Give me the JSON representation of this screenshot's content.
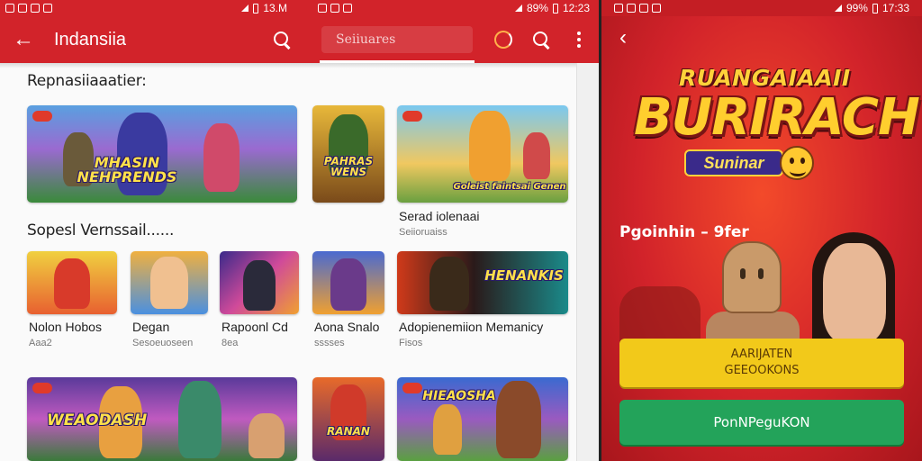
{
  "status_bars": {
    "left_time": "13.M",
    "mid_battery": "89%",
    "mid_time": "12:23",
    "right_battery": "99%",
    "right_time": "17:33"
  },
  "app_bar": {
    "title": "Indansiia",
    "search_placeholder": "Seiiuares"
  },
  "sections": [
    {
      "title": "Repnasiiaaatier:",
      "cards": [
        {
          "art_text": "MHASIN\nNEHPRENDS"
        },
        {
          "art_text": "PAHRAS\nWENS"
        },
        {
          "art_text": "Goleist faintsai Genen",
          "label": "Serad iolenaai",
          "sub": "Seiioruaiss"
        }
      ]
    },
    {
      "title": "Sopesl Vernssail......",
      "cards": [
        {
          "label": "Nolon Hobos",
          "sub": "Aaa2"
        },
        {
          "label": "Degan",
          "sub": "Sesoeuoseen"
        },
        {
          "label": "Rapoonl Cd",
          "sub": "8ea"
        },
        {
          "label": "Aona Snalo",
          "sub": "sssses"
        },
        {
          "art_text": "HENANKIS",
          "label": "Adopienemiion Memanicy",
          "sub": "Fisos"
        }
      ]
    },
    {
      "title": "",
      "cards": [
        {
          "art_text": "WEAODASH"
        },
        {
          "art_text": "RANAN"
        },
        {
          "art_text": "HIEAOSHA"
        }
      ]
    }
  ],
  "promo": {
    "logo_top": "RUANGAIAAII",
    "logo_main": "BURIRACH",
    "logo_sub": "Suninar",
    "heading": "Pgoinhin – 9fer",
    "btn_primary_line1": "AARIJATEN",
    "btn_primary_line2": "GEEOOKONS",
    "btn_secondary": "PonNPeguKON"
  },
  "colors": {
    "brand_red": "#d2232a",
    "button_yellow": "#f2c91a",
    "button_green": "#23a35a"
  }
}
